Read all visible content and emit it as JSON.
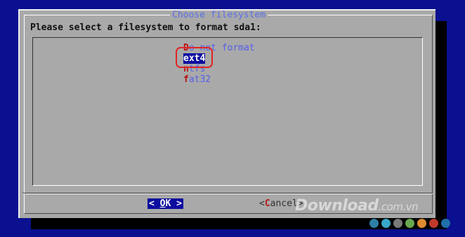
{
  "dialog": {
    "title": "Choose filesystem",
    "prompt": "Please select a filesystem to format sda1:",
    "options": [
      {
        "hotkey": "D",
        "rest": "o not format",
        "selected": false
      },
      {
        "hotkey": "e",
        "rest": "xt4",
        "selected": true
      },
      {
        "hotkey": "n",
        "rest": "tfs",
        "selected": false
      },
      {
        "hotkey": "f",
        "rest": "at32",
        "selected": false
      }
    ],
    "ok": {
      "left": "< ",
      "hotkey": "O",
      "rest": "K",
      "right": " >"
    },
    "cancel": {
      "left": "<",
      "hotkey": "C",
      "rest": "ancel",
      "right": ">"
    }
  },
  "watermark": {
    "brand": "Download",
    "domain": ".com.vn"
  },
  "watermark_dots": [
    "#2f7fa6",
    "#39a8c9",
    "#7a7a7a",
    "#6aa84f",
    "#e08b2f",
    "#c0392b",
    "#1f6fa8"
  ]
}
